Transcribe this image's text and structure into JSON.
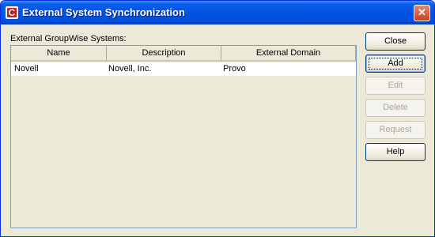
{
  "window": {
    "title": "External System Synchronization"
  },
  "list": {
    "label": "External GroupWise Systems:",
    "columns": [
      "Name",
      "Description",
      "External Domain"
    ],
    "rows": [
      {
        "name": "Novell",
        "description": "Novell, Inc.",
        "domain": "Provo"
      }
    ]
  },
  "buttons": {
    "close": "Close",
    "add": "Add",
    "edit": "Edit",
    "delete": "Delete",
    "request": "Request",
    "help": "Help"
  },
  "icons": {
    "app": "app-c-icon",
    "close": "close-x-icon"
  },
  "colors": {
    "titlebar": "#0054e3",
    "dialog_bg": "#ece9d8",
    "app_icon": "#c8181b"
  }
}
